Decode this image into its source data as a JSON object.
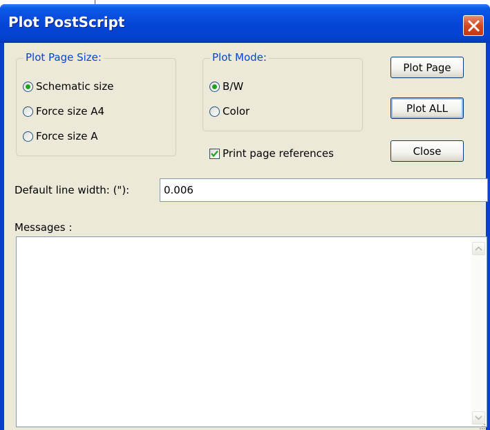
{
  "window": {
    "title": "Plot PostScript",
    "close_icon": "close-icon"
  },
  "plot_page_size": {
    "label": "Plot Page Size:",
    "options": [
      {
        "label": "Schematic size",
        "checked": true
      },
      {
        "label": "Force size A4",
        "checked": false
      },
      {
        "label": "Force size A",
        "checked": false
      }
    ]
  },
  "plot_mode": {
    "label": "Plot Mode:",
    "options": [
      {
        "label": "B/W",
        "checked": true
      },
      {
        "label": "Color",
        "checked": false
      }
    ]
  },
  "print_page_references": {
    "label": "Print page references",
    "checked": true
  },
  "buttons": {
    "plot_page": "Plot Page",
    "plot_all": "Plot ALL",
    "close": "Close"
  },
  "line_width": {
    "label": "Default line width: (\"):",
    "value": "0.006"
  },
  "messages": {
    "label": "Messages :",
    "value": ""
  },
  "colors": {
    "titlebar": "#0546d6",
    "group_label": "#0046d5",
    "face": "#ece9d8",
    "radio_dot": "#21a121"
  }
}
